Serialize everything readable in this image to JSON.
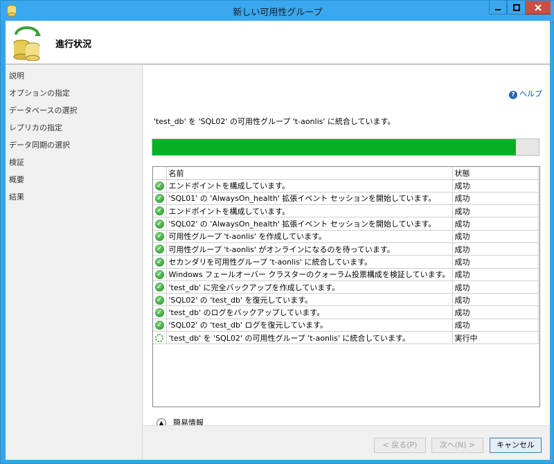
{
  "window": {
    "title": "新しい可用性グループ"
  },
  "header": {
    "title": "進行状況"
  },
  "sidebar": {
    "items": [
      {
        "label": "説明"
      },
      {
        "label": "オプションの指定"
      },
      {
        "label": "データベースの選択"
      },
      {
        "label": "レプリカの指定"
      },
      {
        "label": "データ同期の選択"
      },
      {
        "label": "検証"
      },
      {
        "label": "概要"
      },
      {
        "label": "結果"
      }
    ]
  },
  "main": {
    "help_label": "ヘルプ",
    "status_message": "'test_db' を 'SQL02' の可用性グループ 't-aonlis' に統合しています。",
    "progress_percent": 94,
    "table": {
      "col_name": "名前",
      "col_status": "状態",
      "rows": [
        {
          "icon": "success-icon",
          "name": "エンドポイントを構成しています。",
          "status": "成功"
        },
        {
          "icon": "success-icon",
          "name": "'SQL01' の 'AlwaysOn_health' 拡張イベント セッションを開始しています。",
          "status": "成功"
        },
        {
          "icon": "success-icon",
          "name": "エンドポイントを構成しています。",
          "status": "成功"
        },
        {
          "icon": "success-icon",
          "name": "'SQL02' の 'AlwaysOn_health' 拡張イベント セッションを開始しています。",
          "status": "成功"
        },
        {
          "icon": "success-icon",
          "name": "可用性グループ 't-aonlis' を作成しています。",
          "status": "成功"
        },
        {
          "icon": "success-icon",
          "name": "可用性グループ 't-aonlis' がオンラインになるのを待っています。",
          "status": "成功"
        },
        {
          "icon": "success-icon",
          "name": "セカンダリを可用性グループ 't-aonlis' に統合しています。",
          "status": "成功"
        },
        {
          "icon": "success-icon",
          "name": "Windows フェールオーバー クラスターのクォーラム投票構成を検証しています。",
          "status": "成功"
        },
        {
          "icon": "success-icon",
          "name": "'test_db' に完全バックアップを作成しています。",
          "status": "成功"
        },
        {
          "icon": "success-icon",
          "name": "'SQL02' の 'test_db' を復元しています。",
          "status": "成功"
        },
        {
          "icon": "success-icon",
          "name": "'test_db' のログをバックアップしています。",
          "status": "成功"
        },
        {
          "icon": "success-icon",
          "name": "'SQL02' の 'test_db' ログを復元しています。",
          "status": "成功"
        },
        {
          "icon": "running-icon",
          "name": "'test_db' を 'SQL02' の可用性グループ 't-aonlis' に統合しています。",
          "status": "実行中"
        }
      ]
    },
    "details_label": "簡易情報"
  },
  "footer": {
    "back_label": "< 戻る(P)",
    "next_label": "次へ(N) >",
    "cancel_label": "キャンセル"
  },
  "colors": {
    "progress_fill": "#06b025",
    "titlebar": "#3aa8ee",
    "close_button": "#c74f44"
  }
}
